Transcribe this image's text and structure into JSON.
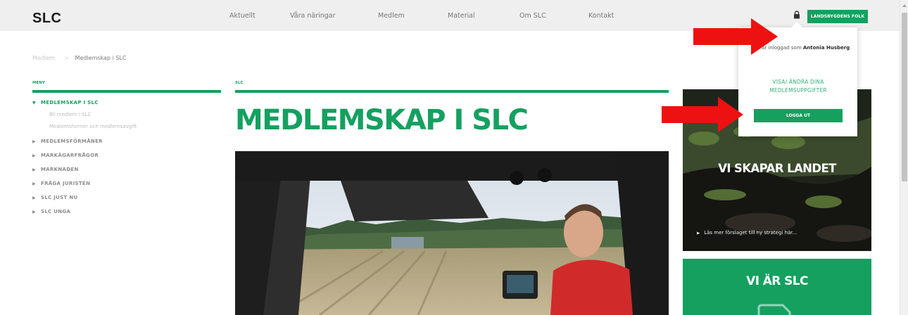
{
  "header": {
    "logo": "SLC",
    "nav": [
      "Aktuellt",
      "Våra näringar",
      "Medlem",
      "Material",
      "Om SLC",
      "Kontakt"
    ],
    "account_button": "LANDSBYGDENS FOLK"
  },
  "breadcrumb": {
    "parent": "Medlem",
    "separator": ">",
    "current": "Medlemskap i SLC"
  },
  "sidebar": {
    "label": "MENY",
    "items": [
      {
        "label": "MEDLEMSKAP I SLC"
      },
      {
        "label": "MEDLEMSFÖRMÅNER"
      },
      {
        "label": "MARKÄGARFRÅGOR"
      },
      {
        "label": "MARKNADEN"
      },
      {
        "label": "FRÅGA JURISTEN"
      },
      {
        "label": "SLC JUST NU"
      },
      {
        "label": "SLC UNGA"
      }
    ],
    "subitems": [
      {
        "label": "Bli medlem i SLC"
      },
      {
        "label": "Medlemsformer och medlemsavgift"
      }
    ]
  },
  "main": {
    "section_label": "SLC",
    "title": "MEDLEMSKAP I SLC"
  },
  "promo": {
    "title": "VI SKAPAR LANDET",
    "link": "Läs mer förslaget till ny strategi här..."
  },
  "card": {
    "title": "VI ÄR SLC"
  },
  "popup": {
    "logged_in_prefix": "Du är inloggad som ",
    "user_name": "Antonia Husberg",
    "edit_link": "VISA/ ÄNDRA DINA MEDLEMSUPPGIFTER",
    "logout_button": "LOGGA UT"
  },
  "colors": {
    "brand_green": "#15a060",
    "annotation_red": "#ee1111"
  }
}
